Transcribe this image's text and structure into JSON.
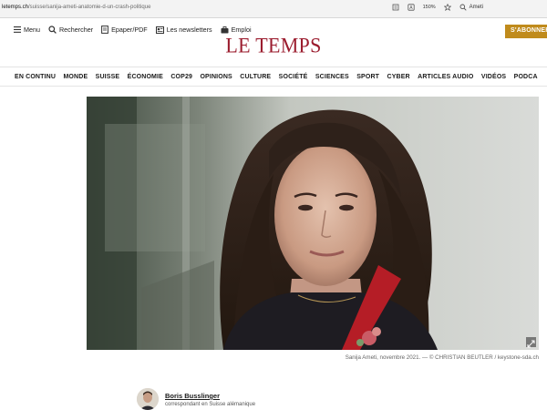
{
  "browser": {
    "url_domain": "letemps.ch",
    "url_path": "/suisse/sanija-ameti-anatomie-d-un-crash-politique",
    "zoom": "150%",
    "search_text": "Ameti"
  },
  "header": {
    "logo": "LE TEMPS",
    "subscribe_label": "S'ABONNER",
    "utils": [
      {
        "label": "Menu",
        "icon": "hamburger-icon"
      },
      {
        "label": "Rechercher",
        "icon": "search-icon"
      },
      {
        "label": "Epaper/PDF",
        "icon": "document-icon"
      },
      {
        "label": "Les newsletters",
        "icon": "newsletter-icon"
      },
      {
        "label": "Emploi",
        "icon": "briefcase-icon"
      }
    ]
  },
  "nav": {
    "items": [
      "EN CONTINU",
      "MONDE",
      "SUISSE",
      "ÉCONOMIE",
      "COP29",
      "OPINIONS",
      "CULTURE",
      "SOCIÉTÉ",
      "SCIENCES",
      "SPORT",
      "CYBER",
      "ARTICLES AUDIO",
      "VIDÉOS",
      "PODCA"
    ]
  },
  "article": {
    "caption": "Sanija Ameti, novembre 2021. — © CHRISTIAN BEUTLER / keystone-sda.ch",
    "author_name": "Boris Busslinger",
    "author_role": "correspondant en Suisse alémanique"
  },
  "colors": {
    "brand": "#9b1c2e",
    "subscribe": "#c08b1c"
  }
}
